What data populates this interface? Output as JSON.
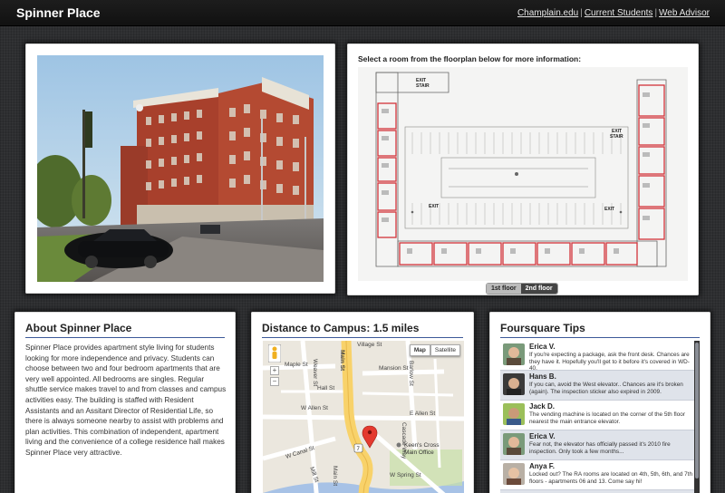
{
  "header": {
    "title": "Spinner Place",
    "links": [
      "Champlain.edu",
      "Current Students",
      "Web Advisor"
    ],
    "separator": "|"
  },
  "floorplan": {
    "heading": "Select a room from the floorplan below for more information:",
    "tabs": [
      "1st floor",
      "2nd floor"
    ],
    "active_tab": "1st floor",
    "labels": {
      "exit_stair_1": "EXIT",
      "exit_stair_2": "STAIR",
      "exit_stair_3": "EXIT",
      "exit_stair_4": "STAIR",
      "exit_left": "EXIT",
      "exit_right": "EXIT"
    }
  },
  "about": {
    "title": "About Spinner Place",
    "body": "Spinner Place provides apartment style living for students looking for more independence and privacy. Students can choose between two and four bedroom apartments that are very well appointed. All bedrooms are singles. Regular shuttle service makes travel to and from classes and campus activities easy. The building is staffed with Resident Assistants and an Assitant Director of Residential Life, so there is always someone nearby to assist with problems and plan activities. This combination of independent, apartment living and the convenience of a college residence hall makes Spinner Place very attractive."
  },
  "distance": {
    "title": "Distance to Campus: 1.5 miles",
    "map_types": [
      "Map",
      "Satellite"
    ],
    "active_map_type": "Map",
    "zoom_in": "+",
    "zoom_out": "−",
    "streets": {
      "main_st": "Main St",
      "main_st_lower": "Main St",
      "maple_st": "Maple St",
      "mansion_st": "Mansion St",
      "w_allen_st": "W Allen St",
      "e_allen_st": "E Allen St",
      "w_canal_st": "W Canal St",
      "weaver_st": "Weaver St",
      "barlow_st": "Barlow St",
      "cascade_way": "Cascade Way",
      "hall_st": "Hall St",
      "village_st": "Village St",
      "mill_st": "Mill St",
      "w_spring_st": "W Spring St"
    },
    "route_number": "7",
    "poi": "Keen's Crossing Main Office",
    "poi_line1": "Keen's Cross",
    "poi_line2": "Main Office"
  },
  "tips": {
    "title": "Foursquare Tips",
    "items": [
      {
        "name": "Erica V.",
        "text": "If you're expecting a package, ask the front desk. Chances are they have it. Hopefully you'll get to it before it's covered in WD-40."
      },
      {
        "name": "Hans B.",
        "text": "If you can, avoid the West elevator.. Chances are it's broken (again). The inspection sticker also expired in 2009."
      },
      {
        "name": "Jack D.",
        "text": "The vending machine is located on the corner of the 5th floor nearest the main entrance elevator."
      },
      {
        "name": "Erica V.",
        "text": "Fear not, the elevator has officially passed it's 2010 fire inspection. Only took a few months..."
      },
      {
        "name": "Anya F.",
        "text": "Locked out? The RA rooms are located on 4th, 5th, 6th, and 7th floors - apartments 06 and 13. Come say hi!"
      }
    ]
  },
  "colors": {
    "accent": "#3d5a99",
    "floor_highlight": "#d2333a",
    "background": "#2e2f31"
  }
}
